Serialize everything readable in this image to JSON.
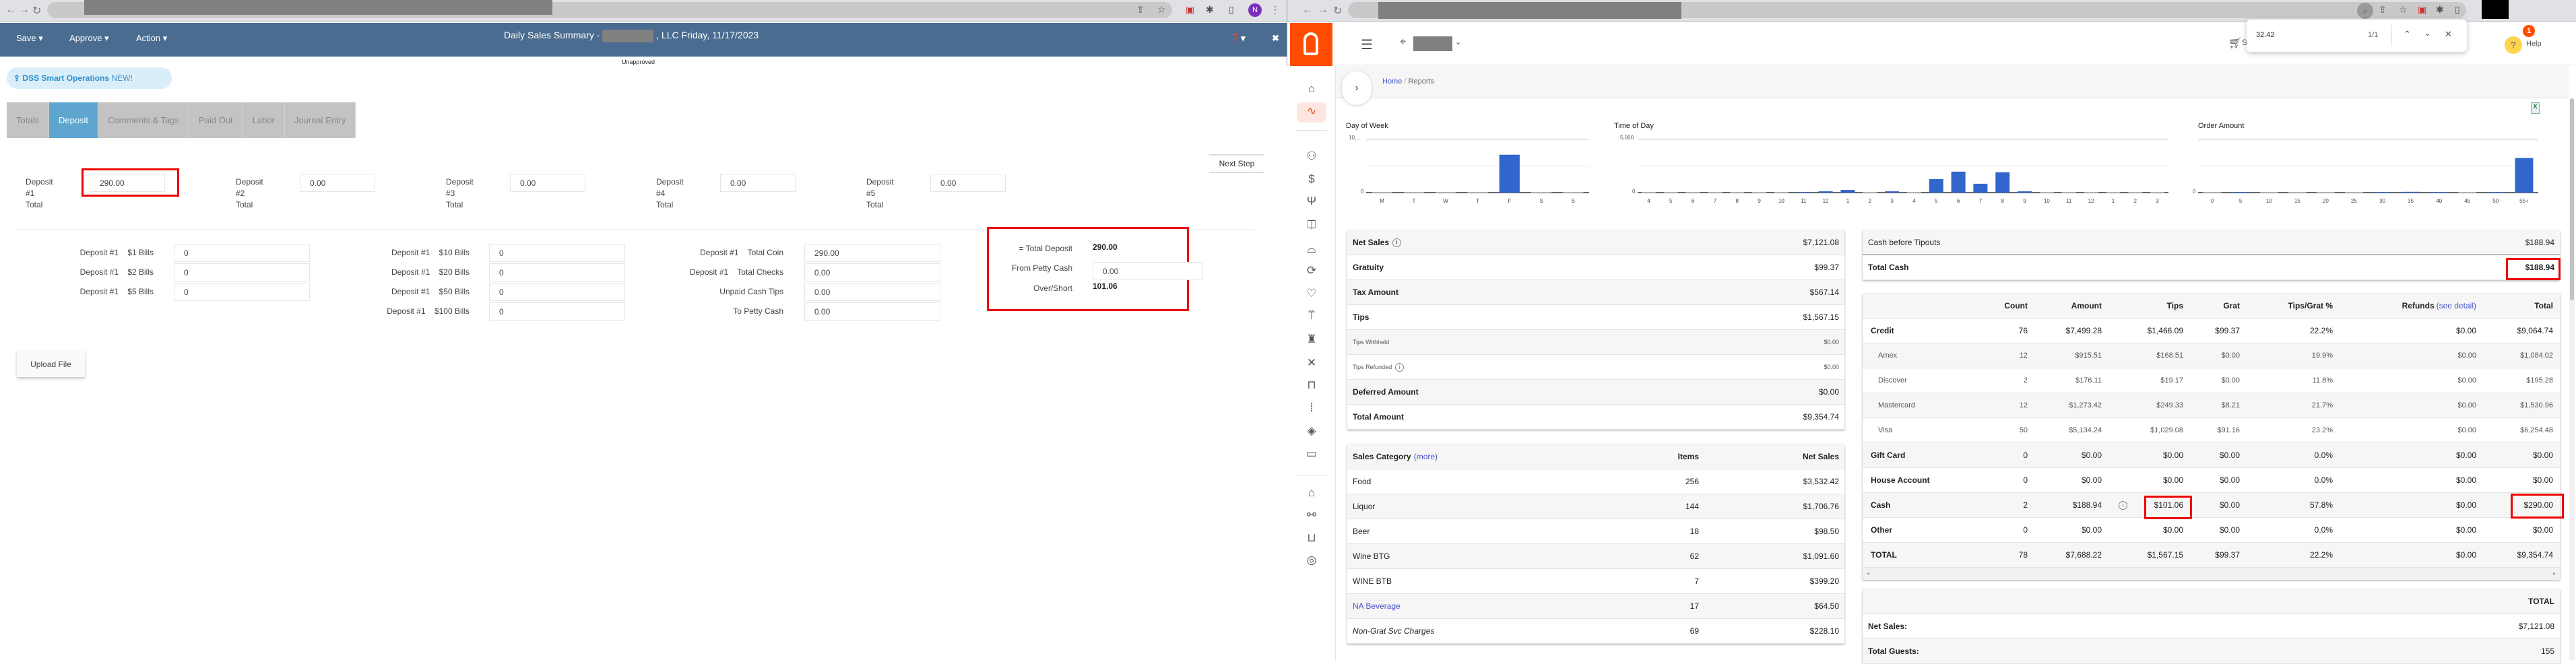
{
  "left": {
    "menu": {
      "save": "Save ▾",
      "approve": "Approve ▾",
      "action": "Action ▾"
    },
    "title_prefix": "Daily Sales Summary -",
    "title_suffix": ", LLC Friday, 11/17/2023",
    "status": "Unapproved",
    "dss_badge": {
      "label": "DSS Smart Operations",
      "new": "NEW!"
    },
    "tabs": [
      "Totals",
      "Deposit",
      "Comments & Tags",
      "Paid Out",
      "Labor",
      "Journal Entry"
    ],
    "active_tab": "Deposit",
    "next_step": "Next Step",
    "deposits": [
      {
        "l1": "Deposit",
        "l2": "#1",
        "l3": "Total",
        "value": "290.00"
      },
      {
        "l1": "Deposit",
        "l2": "#2",
        "l3": "Total",
        "value": "0.00"
      },
      {
        "l1": "Deposit",
        "l2": "#3",
        "l3": "Total",
        "value": "0.00"
      },
      {
        "l1": "Deposit",
        "l2": "#4",
        "l3": "Total",
        "value": "0.00"
      },
      {
        "l1": "Deposit",
        "l2": "#5",
        "l3": "Total",
        "value": "0.00"
      }
    ],
    "bills_col1": [
      {
        "label": "Deposit #1    $1 Bills",
        "value": "0"
      },
      {
        "label": "Deposit #1    $2 Bills",
        "value": "0"
      },
      {
        "label": "Deposit #1    $5 Bills",
        "value": "0"
      }
    ],
    "bills_col2": [
      {
        "label": "Deposit #1    $10 Bills",
        "value": "0"
      },
      {
        "label": "Deposit #1    $20 Bills",
        "value": "0"
      },
      {
        "label": "Deposit #1    $50 Bills",
        "value": "0"
      },
      {
        "label": "Deposit #1    $100 Bills",
        "value": "0"
      }
    ],
    "bills_col3": [
      {
        "label": "Deposit #1    Total Coin",
        "value": "290.00"
      },
      {
        "label": "Deposit #1    Total Checks",
        "value": "0.00"
      },
      {
        "label": "Unpaid Cash Tips",
        "value": "0.00"
      },
      {
        "label": "To Petty Cash",
        "value": "0.00"
      }
    ],
    "summary": {
      "total_deposit_label": "= Total Deposit",
      "total_deposit": "290.00",
      "petty_label": "From Petty Cash",
      "petty": "0.00",
      "over_short_label": "Over/Short",
      "over_short": "101.06"
    },
    "upload": "Upload File"
  },
  "right": {
    "find": {
      "query": "32.42",
      "count": "1/1"
    },
    "help": "Help",
    "help_badge": "1",
    "cart_letter": "S",
    "breadcrumb": {
      "home": "Home",
      "sep": "/",
      "current": "Reports"
    },
    "net_summary": [
      {
        "label": "Net Sales",
        "value": "$7,121.08",
        "info": true,
        "style": "b"
      },
      {
        "label": "Gratuity",
        "value": "$99.37",
        "style": "b"
      },
      {
        "label": "Tax Amount",
        "value": "$567.14",
        "style": "b"
      },
      {
        "label": "Tips",
        "value": "$1,567.15",
        "style": "b"
      },
      {
        "label": "Tips Withheld",
        "value": "$0.00",
        "style": "small"
      },
      {
        "label": "Tips Refunded",
        "value": "$0.00",
        "info": true,
        "style": "small"
      },
      {
        "label": "Deferred Amount",
        "value": "$0.00",
        "style": "b"
      },
      {
        "label": "Total Amount",
        "value": "$9,354.74",
        "style": "b"
      }
    ],
    "sales_category": {
      "header": {
        "label": "Sales Category",
        "more": "(more)",
        "items": "Items",
        "net": "Net Sales"
      },
      "rows": [
        {
          "label": "Food",
          "items": "256",
          "net": "$3,532.42"
        },
        {
          "label": "Liquor",
          "items": "144",
          "net": "$1,706.76"
        },
        {
          "label": "Beer",
          "items": "18",
          "net": "$98.50"
        },
        {
          "label": "Wine BTG",
          "items": "62",
          "net": "$1,091.60"
        },
        {
          "label": "WINE BTB",
          "items": "7",
          "net": "$399.20"
        },
        {
          "label": "NA Beverage",
          "items": "17",
          "net": "$64.50"
        },
        {
          "label": "Non-Grat Svc Charges",
          "items": "69",
          "net": "$228.10"
        }
      ]
    },
    "cash": [
      {
        "label": "Cash before Tipouts",
        "value": "$188.94"
      },
      {
        "label": "Total Cash",
        "value": "$188.94"
      }
    ],
    "payments": {
      "headers": [
        "",
        "Count",
        "Amount",
        "Tips",
        "Grat",
        "Tips/Grat %",
        "Refunds",
        "Total"
      ],
      "see_detail": "(see detail)",
      "rows": [
        {
          "cells": [
            "Credit",
            "76",
            "$7,499.28",
            "$1,466.09",
            "$99.37",
            "22.2%",
            "$0.00",
            "$9,064.74"
          ],
          "sub": false
        },
        {
          "cells": [
            "Amex",
            "12",
            "$915.51",
            "$168.51",
            "$0.00",
            "19.9%",
            "$0.00",
            "$1,084.02"
          ],
          "sub": true
        },
        {
          "cells": [
            "Discover",
            "2",
            "$176.11",
            "$19.17",
            "$0.00",
            "11.8%",
            "$0.00",
            "$195.28"
          ],
          "sub": true
        },
        {
          "cells": [
            "Mastercard",
            "12",
            "$1,273.42",
            "$249.33",
            "$8.21",
            "21.7%",
            "$0.00",
            "$1,530.96"
          ],
          "sub": true
        },
        {
          "cells": [
            "Visa",
            "50",
            "$5,134.24",
            "$1,029.08",
            "$91.16",
            "23.2%",
            "$0.00",
            "$6,254.48"
          ],
          "sub": true
        },
        {
          "cells": [
            "Gift Card",
            "0",
            "$0.00",
            "$0.00",
            "$0.00",
            "0.0%",
            "$0.00",
            "$0.00"
          ],
          "sub": false
        },
        {
          "cells": [
            "House Account",
            "0",
            "$0.00",
            "$0.00",
            "$0.00",
            "0.0%",
            "$0.00",
            "$0.00"
          ],
          "sub": false
        },
        {
          "cells": [
            "Cash",
            "2",
            "$188.94",
            "$101.06",
            "$0.00",
            "57.8%",
            "$0.00",
            "$290.00"
          ],
          "sub": false
        },
        {
          "cells": [
            "Other",
            "0",
            "$0.00",
            "$0.00",
            "$0.00",
            "0.0%",
            "$0.00",
            "$0.00"
          ],
          "sub": false
        },
        {
          "cells": [
            "TOTAL",
            "78",
            "$7,688.22",
            "$1,567.15",
            "$99.37",
            "22.2%",
            "$0.00",
            "$9,354.74"
          ],
          "sub": false
        }
      ]
    },
    "totals_card": {
      "header": "TOTAL",
      "rows": [
        {
          "label": "Net Sales:",
          "value": "$7,121.08"
        },
        {
          "label": "Total Guests:",
          "value": "155"
        }
      ]
    }
  },
  "chart_data": [
    {
      "type": "bar",
      "title": "Day of Week",
      "ytick": "10,...",
      "ylim": [
        0,
        10000
      ],
      "categories": [
        "M",
        "T",
        "W",
        "T",
        "F",
        "S",
        "S"
      ],
      "values": [
        0,
        0,
        0,
        0,
        7121,
        0,
        0
      ],
      "color": "#3366cc"
    },
    {
      "type": "bar",
      "title": "Time of Day",
      "ytick": "5,000",
      "ylim": [
        0,
        5000
      ],
      "categories": [
        "4",
        "5",
        "6",
        "7",
        "8",
        "9",
        "10",
        "11",
        "12",
        "1",
        "2",
        "3",
        "4",
        "5",
        "6",
        "7",
        "8",
        "9",
        "10",
        "11",
        "12",
        "1",
        "2",
        "3"
      ],
      "values": [
        0,
        0,
        0,
        0,
        0,
        0,
        0,
        50,
        120,
        250,
        0,
        120,
        0,
        1270,
        1970,
        830,
        1910,
        120,
        0,
        0,
        0,
        0,
        0,
        0
      ],
      "color": "#3366cc"
    },
    {
      "type": "bar",
      "title": "Order Amount",
      "ytick": "",
      "ylim": [
        0,
        10000
      ],
      "categories": [
        "0",
        "5",
        "10",
        "15",
        "20",
        "25",
        "30",
        "35",
        "40",
        "45",
        "50",
        "55+"
      ],
      "values": [
        0,
        20,
        0,
        0,
        0,
        0,
        20,
        150,
        20,
        0,
        30,
        6500
      ],
      "color": "#3366cc"
    }
  ]
}
